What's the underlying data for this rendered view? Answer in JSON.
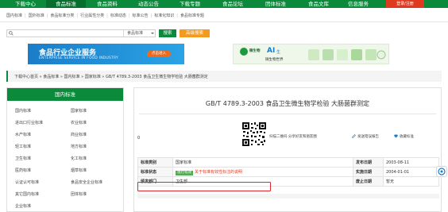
{
  "topnav": {
    "items": [
      "下载中心",
      "食品标准",
      "食品资料",
      "动态公告",
      "下载专题",
      "食品论坛",
      "团体标准",
      "食品文库",
      "信息服务"
    ],
    "login": "登录/注册"
  },
  "subnav": {
    "items": [
      "国内标准",
      "国外标准",
      "食品标准分类",
      "行业属性分类",
      "标准动态",
      "标准公告",
      "标准化知识",
      "食品标准专题"
    ]
  },
  "search": {
    "placeholder": "",
    "select_value": "食品标准",
    "search_label": "搜索",
    "advanced_label": "高级搜索"
  },
  "banner_left": {
    "title": "食品行业企业服务",
    "subtitle": "ENTERPRISE SERVICE IN FOOD INDUSTRY",
    "button": "点击进入"
  },
  "banner_right": {
    "brand": "微生物",
    "ai": "AI",
    "ai_sub": "生",
    "subtitle": "微生物世界"
  },
  "breadcrumb": "下载中心首页 » 食品标准 » 国内标准 » 国家标准 » GB/T 4789.3-2003 食品卫生微生物学检验 大肠菌群测定",
  "sidebar": {
    "title": "国内标准",
    "items": [
      "国内标准",
      "国家标准",
      "进出口行业标准",
      "农业标准",
      "水产标准",
      "商业标准",
      "轻工标准",
      "地方标准",
      "卫生标准",
      "化工标准",
      "医药标准",
      "烟草标准",
      "认证认可标准",
      "食品安全企业标准",
      "其它国内标准",
      "团体标准",
      "企业标准",
      ""
    ]
  },
  "detail": {
    "title": "GB/T 4789.3-2003 食品卫生微生物学检验 大肠菌群测定",
    "count": "0",
    "scan_text": "扫描二维码 分享好友和朋友圈",
    "error_link": "发送错误报告",
    "favorite": "收藏标准",
    "rows": [
      {
        "label": "标准类别",
        "value": "国家标准",
        "label2": "发布日期",
        "value2": "2003-08-11"
      },
      {
        "label": "标准状态",
        "badge": "现行有效",
        "note": "关于标准有效性标注的说明",
        "label2": "实施日期",
        "value2": "2004-01-01"
      },
      {
        "label": "颁发部门",
        "value": "卫生部",
        "label2": "废止日期",
        "value2": "暂无"
      }
    ]
  },
  "colors": {
    "brand_green": "#0a8a3a",
    "orange": "#f39a1f",
    "red": "#e03a1e"
  }
}
